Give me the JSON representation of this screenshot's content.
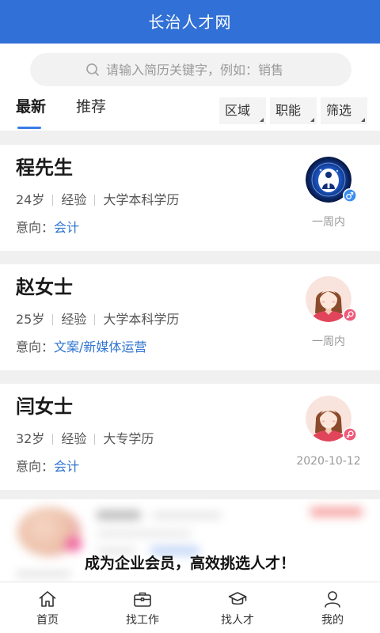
{
  "colors": {
    "header_bg": "#3170d6",
    "accent": "#3a7be8",
    "link": "#2f74d0",
    "male_badge": "#3b8ef0",
    "female_badge": "#ee5a79"
  },
  "header": {
    "title": "长治人才网"
  },
  "search": {
    "placeholder": "请输入简历关键字，例如：销售",
    "icon": "search-icon"
  },
  "tabs": [
    {
      "label": "最新",
      "active": true
    },
    {
      "label": "推荐",
      "active": false
    }
  ],
  "filters": [
    {
      "label": "区域",
      "icon": "dropdown-corner-icon"
    },
    {
      "label": "职能",
      "icon": "dropdown-corner-icon"
    },
    {
      "label": "筛选",
      "icon": "dropdown-corner-icon"
    }
  ],
  "candidates": [
    {
      "name": "程先生",
      "age": "24岁",
      "experience": "经验",
      "education": "大学本科学历",
      "intent_label": "意向：",
      "intent": "会计",
      "time": "一周内",
      "avatar_icon": "logo-avatar-icon",
      "gender_icon": "male-icon"
    },
    {
      "name": "赵女士",
      "age": "25岁",
      "experience": "经验",
      "education": "大学本科学历",
      "intent_label": "意向：",
      "intent": "文案/新媒体运营",
      "time": "一周内",
      "avatar_icon": "female-avatar-icon",
      "gender_icon": "female-icon"
    },
    {
      "name": "闫女士",
      "age": "32岁",
      "experience": "经验",
      "education": "大专学历",
      "intent_label": "意向：",
      "intent": "会计",
      "time": "2020-10-12",
      "avatar_icon": "female-avatar-icon",
      "gender_icon": "female-icon"
    }
  ],
  "member_promo": {
    "text": "成为企业会员，高效挑选人才！"
  },
  "bottom_nav": [
    {
      "label": "首页",
      "icon": "home-icon"
    },
    {
      "label": "找工作",
      "icon": "briefcase-icon"
    },
    {
      "label": "找人才",
      "icon": "graduation-cap-icon"
    },
    {
      "label": "我的",
      "icon": "user-icon"
    }
  ]
}
